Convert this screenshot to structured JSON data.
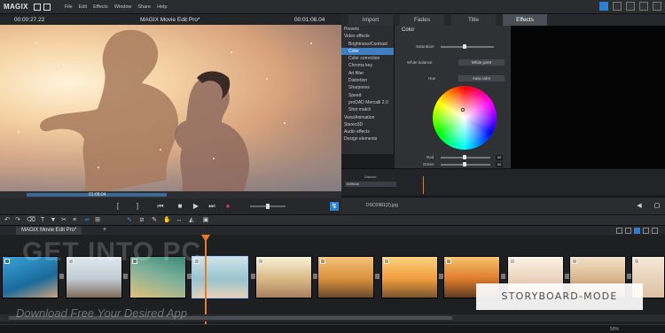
{
  "app": {
    "logo": "MAGIX",
    "menu": [
      "File",
      "Edit",
      "Effects",
      "Window",
      "Share",
      "Help"
    ]
  },
  "preview": {
    "timecode_left": "00:00:27.22",
    "title": "MAGIX Movie Edit Pro*",
    "timecode_right": "00:01:08.04",
    "scrub_label": "01:08:04",
    "scrub_progress": 0.44
  },
  "tabs": [
    {
      "label": "Import"
    },
    {
      "label": "Fades"
    },
    {
      "label": "Title"
    },
    {
      "label": "Effects",
      "active": true
    }
  ],
  "fx_list": [
    {
      "label": "Presets",
      "sub": false
    },
    {
      "label": "Video effects",
      "sub": false
    },
    {
      "label": "Brightness/Contrast",
      "sub": true
    },
    {
      "label": "Color",
      "sub": true,
      "selected": true
    },
    {
      "label": "Color correction",
      "sub": true
    },
    {
      "label": "Chroma key",
      "sub": true
    },
    {
      "label": "Art filter",
      "sub": true
    },
    {
      "label": "Distortion",
      "sub": true
    },
    {
      "label": "Sharpness",
      "sub": true
    },
    {
      "label": "Speed",
      "sub": true
    },
    {
      "label": "proDAD Mercalli 2.0",
      "sub": true
    },
    {
      "label": "Shot match",
      "sub": true
    },
    {
      "label": "View/Animation",
      "sub": false
    },
    {
      "label": "Stereo3D",
      "sub": false
    },
    {
      "label": "Audio effects",
      "sub": false
    },
    {
      "label": "Design elements",
      "sub": false
    }
  ],
  "color_panel": {
    "title": "Color",
    "saturation_label": "Saturation",
    "white_balance_label": "White balance",
    "white_point_btn": "White point",
    "hue_label": "Hue",
    "auto_color_btn": "Auto color",
    "red_label": "Red",
    "green_label": "Green",
    "red_value": "50",
    "green_value": "50"
  },
  "mini_timeline": {
    "label": "Dialude",
    "track": "Artificial"
  },
  "footer": {
    "file": "DSC0981(2).jpg"
  },
  "storyboard": {
    "tab": "MAGIX Movie Edit Pro*",
    "playhead_clip_index": 3
  },
  "watermark": {
    "big": "GET INTO PC",
    "sub": "Download Free Your Desired App"
  },
  "badge": "STORYBOARD-MODE",
  "status": {
    "zoom": "50%"
  },
  "colors": {
    "accent": "#2f7fd0",
    "playhead": "#e87b2a"
  }
}
